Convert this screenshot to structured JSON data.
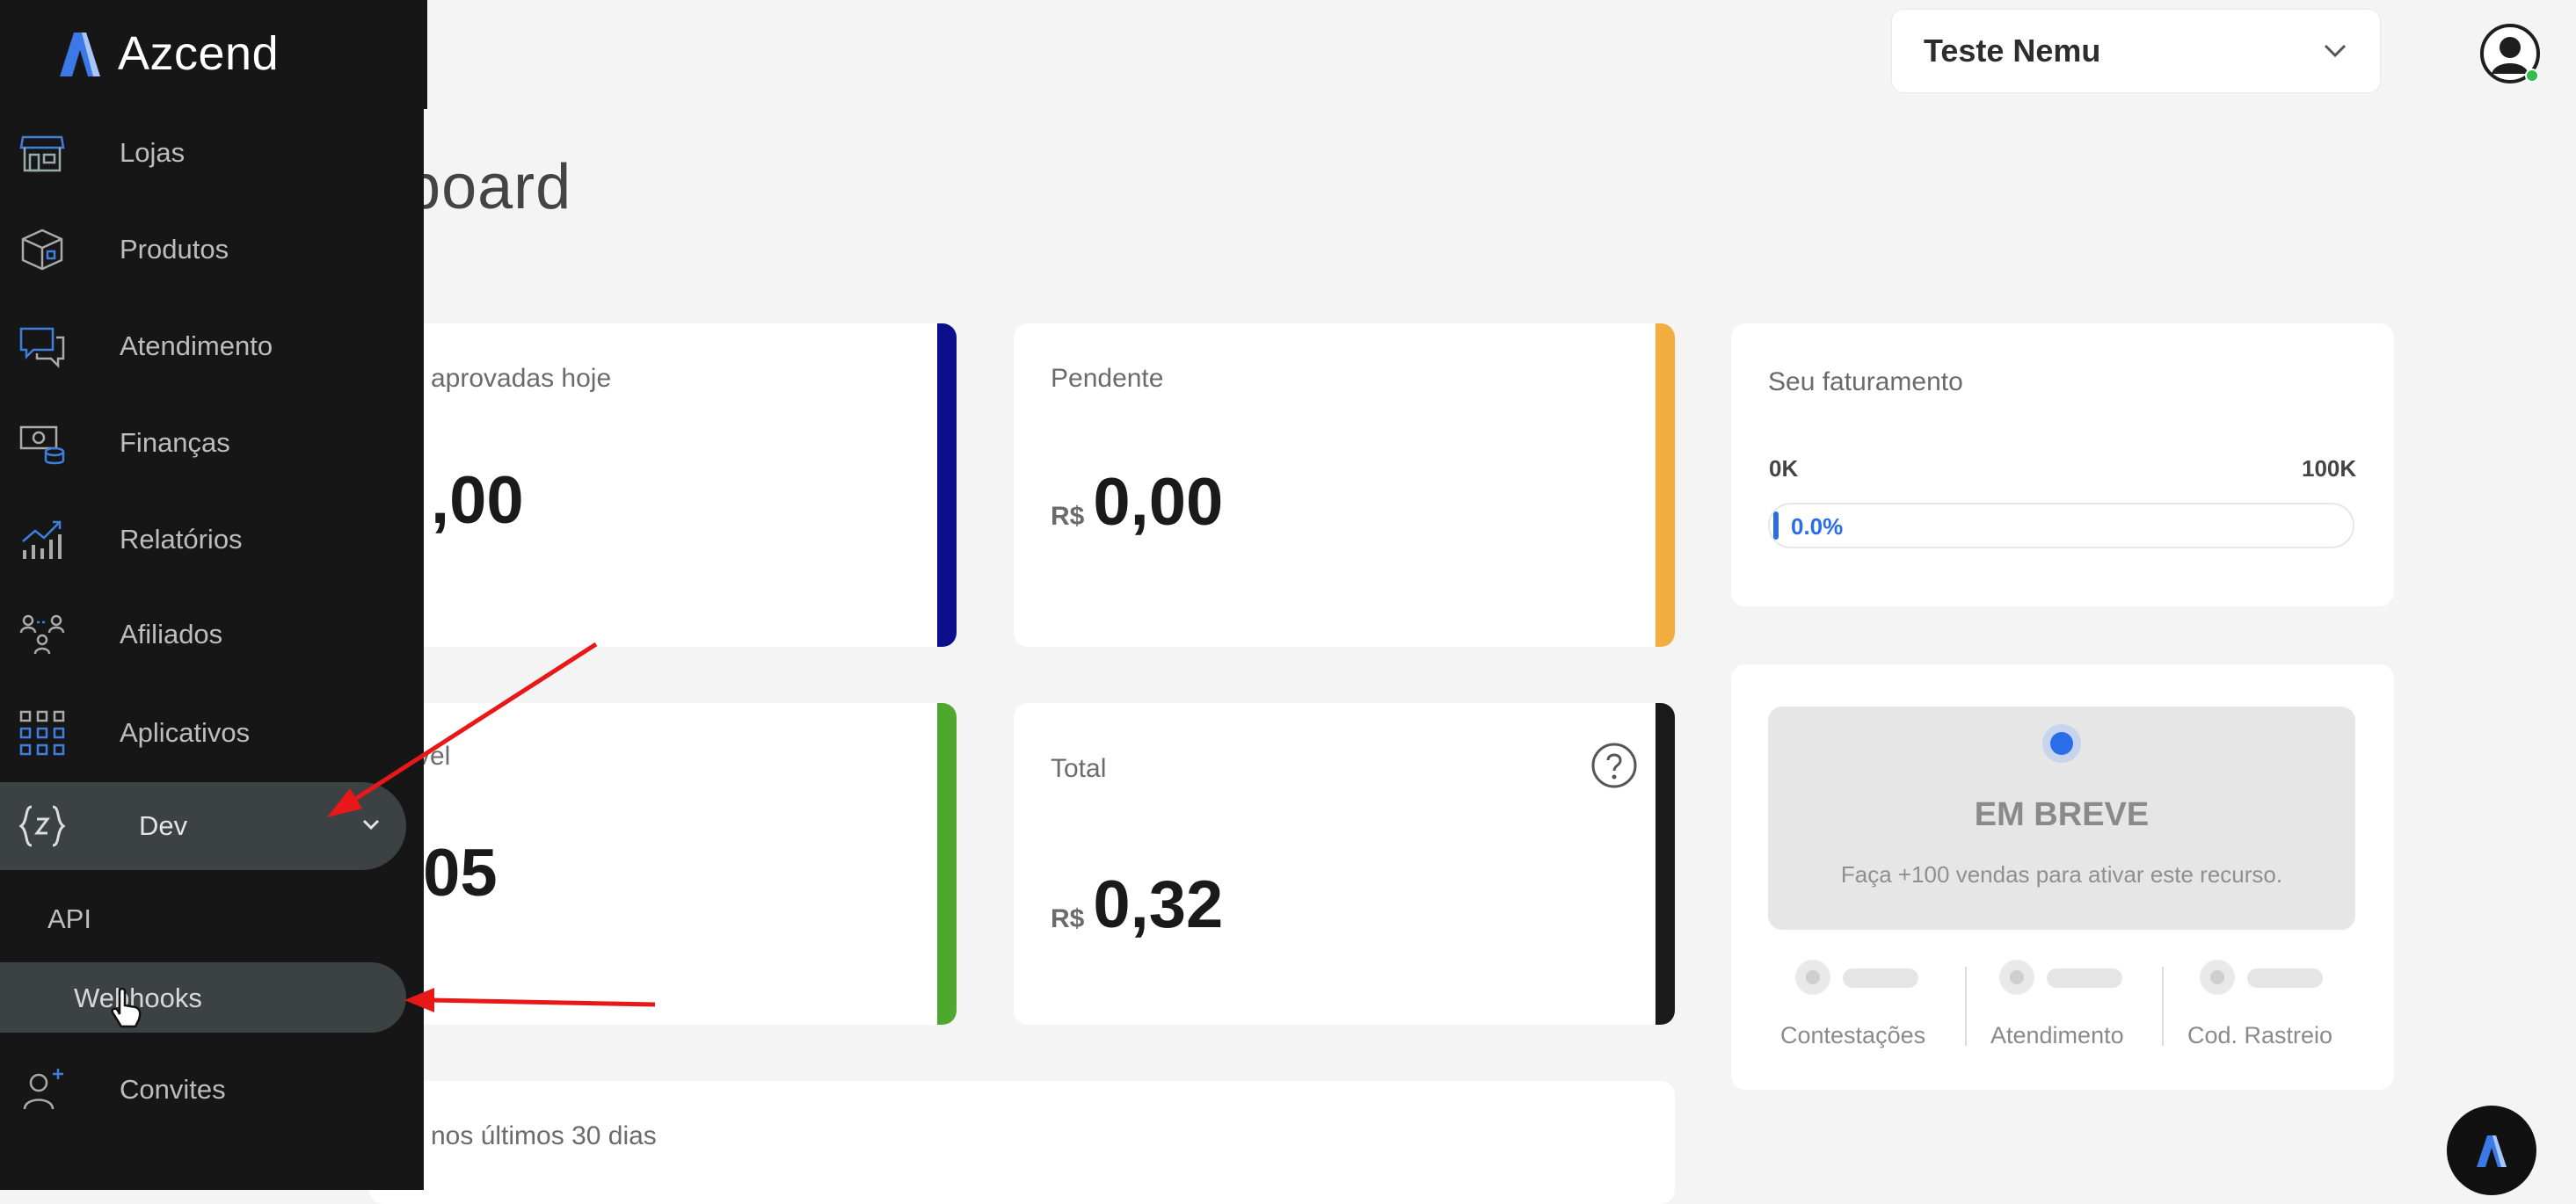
{
  "brand": {
    "name": "Azcend",
    "accent": "#2a6de8"
  },
  "header": {
    "company": "Teste Nemu"
  },
  "page": {
    "title_visible": "nboard"
  },
  "cards": {
    "approved": {
      "label": "aprovadas hoje",
      "amount": ",00",
      "bar_color": "#0b0f8a"
    },
    "pending": {
      "label": "Pendente",
      "currency": "R$",
      "amount": "0,00",
      "bar_color": "#f2ad3e"
    },
    "available": {
      "label": "vel",
      "amount": ",05",
      "bar_color": "#4ea72e"
    },
    "total": {
      "label": "Total",
      "currency": "R$",
      "amount": "0,32",
      "bar_color": "#1a1a1a"
    },
    "last30": {
      "label": "nos últimos 30 dias"
    }
  },
  "revenue": {
    "title": "Seu faturamento",
    "min": "0K",
    "max": "100K",
    "progress_pct": "0.0%",
    "progress_value": 0.0
  },
  "coming_soon": {
    "title": "EM BREVE",
    "description": "Faça +100 vendas para ativar este recurso.",
    "metrics": [
      "Contestações",
      "Atendimento",
      "Cod. Rastreio"
    ]
  },
  "sidebar": {
    "items": [
      {
        "label": "Lojas",
        "icon": "store-icon"
      },
      {
        "label": "Produtos",
        "icon": "box-icon"
      },
      {
        "label": "Atendimento",
        "icon": "chat-icon"
      },
      {
        "label": "Finanças",
        "icon": "money-icon"
      },
      {
        "label": "Relatórios",
        "icon": "chart-icon"
      },
      {
        "label": "Afiliados",
        "icon": "affiliates-icon"
      },
      {
        "label": "Aplicativos",
        "icon": "apps-grid-icon"
      },
      {
        "label": "Dev",
        "icon": "code-braces-icon",
        "expanded": true
      },
      {
        "label": "Convites",
        "icon": "user-plus-icon"
      }
    ],
    "dev_children": [
      "API",
      "Webhooks"
    ]
  }
}
